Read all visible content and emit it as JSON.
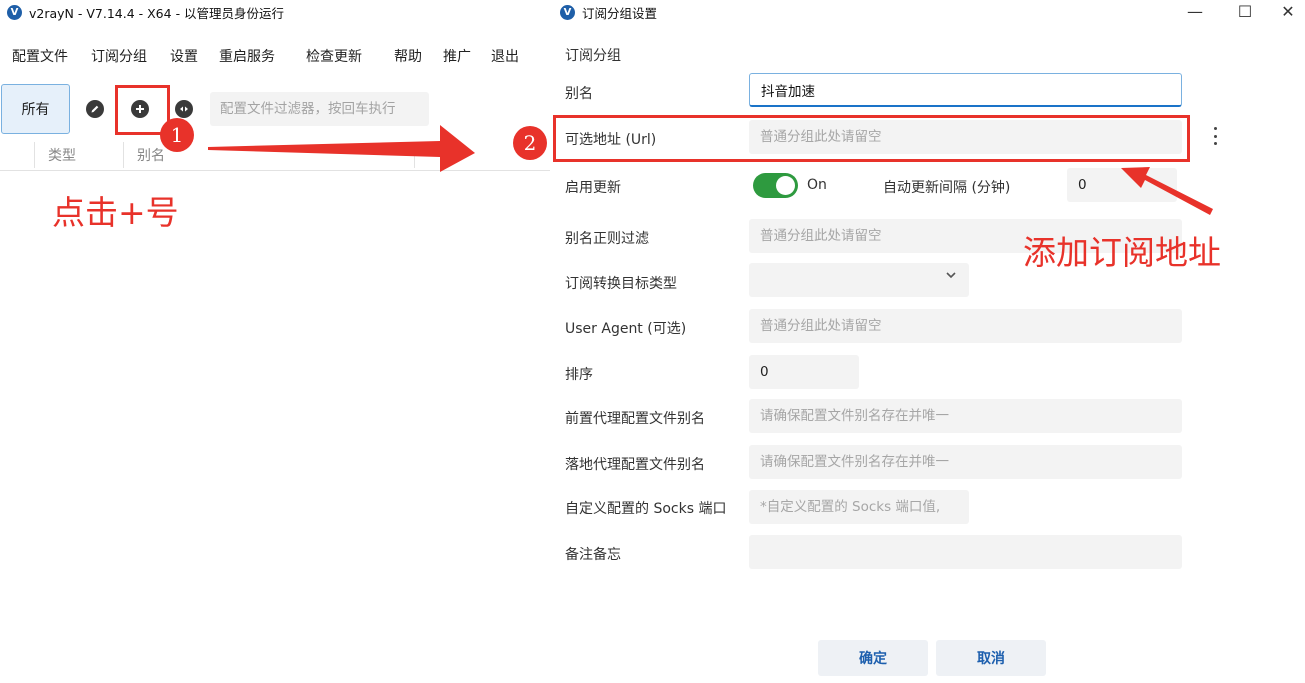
{
  "main_window": {
    "title": "v2rayN - V7.14.4 - X64 - 以管理员身份运行",
    "logo_letter": "V",
    "menu": [
      "配置文件",
      "订阅分组",
      "设置",
      "重启服务",
      "检查更新",
      "帮助",
      "推广",
      "退出"
    ],
    "toolbar": {
      "all_label": "所有",
      "edit_icon": "pencil-icon",
      "add_icon": "plus-circle-icon",
      "share_icon": "share-icon",
      "filter_placeholder": "配置文件过滤器，按回车执行"
    },
    "columns": [
      "类型",
      "别名"
    ]
  },
  "dialog": {
    "title": "订阅分组设置",
    "section_title": "订阅分组",
    "fields": {
      "alias_label": "别名",
      "alias_value": "抖音加速",
      "url_label": "可选地址 (Url)",
      "url_placeholder": "普通分组此处请留空",
      "enable_update_label": "启用更新",
      "enable_update_value": "On",
      "auto_interval_label": "自动更新间隔 (分钟)",
      "auto_interval_value": "0",
      "alias_regex_label": "别名正则过滤",
      "alias_regex_placeholder": "普通分组此处请留空",
      "convert_target_label": "订阅转换目标类型",
      "convert_target_value": "",
      "user_agent_label": "User Agent (可选)",
      "user_agent_placeholder": "普通分组此处请留空",
      "sort_label": "排序",
      "sort_value": "0",
      "prev_proxy_label": "前置代理配置文件别名",
      "prev_proxy_placeholder": "请确保配置文件别名存在并唯一",
      "landing_proxy_label": "落地代理配置文件别名",
      "landing_proxy_placeholder": "请确保配置文件别名存在并唯一",
      "socks_port_label": "自定义配置的 Socks 端口",
      "socks_port_placeholder": "*自定义配置的 Socks 端口值,",
      "remarks_label": "备注备忘",
      "remarks_value": ""
    },
    "ok_label": "确定",
    "cancel_label": "取消"
  },
  "annotations": {
    "step1_number": "1",
    "step2_number": "2",
    "step1_text": "点击+号",
    "step2_text": "添加订阅地址",
    "color": "#e8322a"
  }
}
